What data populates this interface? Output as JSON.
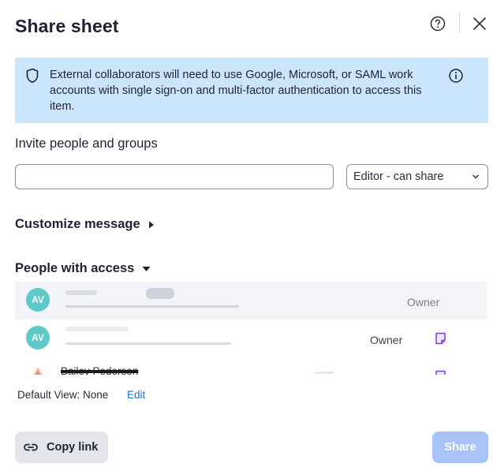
{
  "dialog": {
    "title": "Share sheet"
  },
  "banner": {
    "text": "External collaborators will need to use Google, Microsoft, or SAML work accounts with single sign-on and multi-factor authentication to access this item."
  },
  "invite": {
    "label": "Invite people and groups",
    "input_value": "",
    "placeholder": "",
    "role_selected": "Editor - can share"
  },
  "customize": {
    "label": "Customize message"
  },
  "people": {
    "label": "People with access",
    "rows": [
      {
        "avatar": "AV",
        "role": "Owner"
      },
      {
        "avatar": "AV",
        "role": "Owner"
      },
      {
        "name": "Bailey Pederson"
      }
    ]
  },
  "default_view": {
    "label": "Default View: None",
    "edit_label": "Edit"
  },
  "footer": {
    "copy_link_label": "Copy link",
    "share_label": "Share"
  },
  "colors": {
    "banner_bg": "#cbe6fb",
    "avatar_bg": "#5fc8c8",
    "share_disabled": "#a8c3f7",
    "link": "#1c6fd1",
    "note_icon": "#7b3fd6"
  },
  "icons": {
    "help": "help-circle-icon",
    "close": "close-icon",
    "shield": "shield-icon",
    "info": "info-circle-icon",
    "chevron": "chevron-down-icon",
    "link": "link-icon",
    "note": "note-icon"
  }
}
